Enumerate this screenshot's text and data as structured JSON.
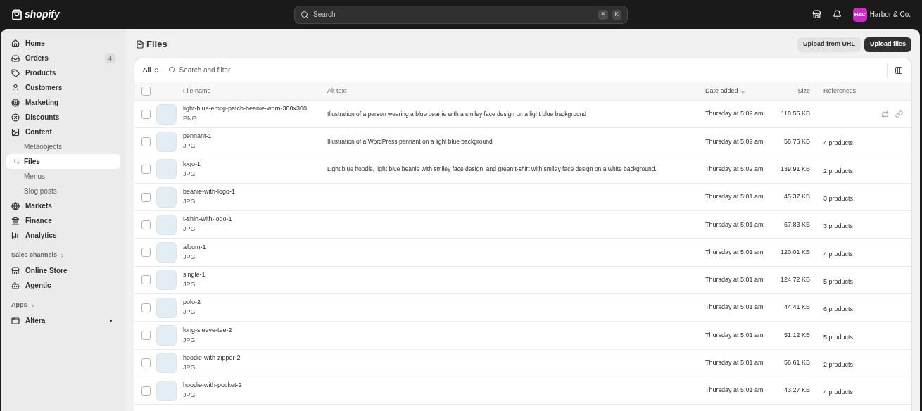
{
  "topbar": {
    "logo": "shopify",
    "search": {
      "placeholder": "Search",
      "shortcut": [
        "⌘",
        "K"
      ]
    },
    "store": {
      "initials": "H&C",
      "name": "Harbor & Co."
    }
  },
  "sidebar": {
    "sections": [
      {
        "items": [
          {
            "label": "Home",
            "selected": false
          },
          {
            "label": "Orders",
            "selected": false,
            "badge": "4"
          },
          {
            "label": "Products",
            "selected": false
          },
          {
            "label": "Customers",
            "selected": false
          },
          {
            "label": "Marketing",
            "selected": false
          },
          {
            "label": "Discounts",
            "selected": false
          },
          {
            "label": "Content",
            "selected": false,
            "children": [
              {
                "label": "Metaobjects",
                "selected": false
              },
              {
                "label": "Files",
                "selected": true
              },
              {
                "label": "Menus",
                "selected": false
              },
              {
                "label": "Blog posts",
                "selected": false
              }
            ]
          },
          {
            "label": "Markets",
            "selected": false
          },
          {
            "label": "Finance",
            "selected": false
          },
          {
            "label": "Analytics",
            "selected": false
          }
        ]
      },
      {
        "heading": "Sales channels",
        "items": [
          {
            "label": "Online Store",
            "selected": false
          },
          {
            "label": "Agentic",
            "selected": false
          }
        ]
      },
      {
        "heading": "Apps",
        "items": [
          {
            "label": "Altera",
            "selected": false,
            "indicator": true
          }
        ]
      }
    ]
  },
  "page": {
    "title": "Files",
    "actions": [
      {
        "label": "Upload from URL",
        "kind": "secondary"
      },
      {
        "label": "Upload files",
        "kind": "primary"
      }
    ]
  },
  "filter": {
    "view": "All",
    "placeholder": "Search and filter"
  },
  "table": {
    "columns": [
      {
        "label": "File name",
        "sorted": false
      },
      {
        "label": "Alt text",
        "sorted": false
      },
      {
        "label": "Date added",
        "sorted": true
      },
      {
        "label": "Size",
        "sorted": false
      },
      {
        "label": "References",
        "sorted": false
      }
    ],
    "all_checked": false,
    "rows": [
      {
        "checked": false,
        "name": "light-blue-emoji-patch-beanie-worn-300x300",
        "type": "PNG",
        "alt": "Illustration of a person wearing a blue beanie with a smiley face design on a light blue background",
        "date": "Thursday at 5:02 am",
        "size": "110.55 KB",
        "references": "",
        "hovered": true
      },
      {
        "checked": false,
        "name": "pennant-1",
        "type": "JPG",
        "alt": "Illustration of a WordPress pennant on a light blue background",
        "date": "Thursday at 5:02 am",
        "size": "56.76 KB",
        "references": "4 products",
        "hovered": false
      },
      {
        "checked": false,
        "name": "logo-1",
        "type": "JPG",
        "alt": "Light blue hoodie, light blue beanie with smiley face design, and green t-shirt with smiley face design on a white background.",
        "date": "Thursday at 5:02 am",
        "size": "139.91 KB",
        "references": "2 products",
        "hovered": false
      },
      {
        "checked": false,
        "name": "beanie-with-logo-1",
        "type": "JPG",
        "alt": "",
        "date": "Thursday at 5:01 am",
        "size": "45.37 KB",
        "references": "3 products",
        "hovered": false
      },
      {
        "checked": false,
        "name": "t-shirt-with-logo-1",
        "type": "JPG",
        "alt": "",
        "date": "Thursday at 5:01 am",
        "size": "67.83 KB",
        "references": "3 products",
        "hovered": false
      },
      {
        "checked": false,
        "name": "album-1",
        "type": "JPG",
        "alt": "",
        "date": "Thursday at 5:01 am",
        "size": "120.01 KB",
        "references": "4 products",
        "hovered": false
      },
      {
        "checked": false,
        "name": "single-1",
        "type": "JPG",
        "alt": "",
        "date": "Thursday at 5:01 am",
        "size": "124.72 KB",
        "references": "5 products",
        "hovered": false
      },
      {
        "checked": false,
        "name": "polo-2",
        "type": "JPG",
        "alt": "",
        "date": "Thursday at 5:01 am",
        "size": "44.41 KB",
        "references": "6 products",
        "hovered": false
      },
      {
        "checked": false,
        "name": "long-sleeve-tee-2",
        "type": "JPG",
        "alt": "",
        "date": "Thursday at 5:01 am",
        "size": "51.12 KB",
        "references": "5 products",
        "hovered": false
      },
      {
        "checked": false,
        "name": "hoodie-with-zipper-2",
        "type": "JPG",
        "alt": "",
        "date": "Thursday at 5:01 am",
        "size": "56.61 KB",
        "references": "2 products",
        "hovered": false
      },
      {
        "checked": false,
        "name": "hoodie-with-pocket-2",
        "type": "JPG",
        "alt": "",
        "date": "Thursday at 5:01 am",
        "size": "43.27 KB",
        "references": "4 products",
        "hovered": false
      }
    ]
  }
}
